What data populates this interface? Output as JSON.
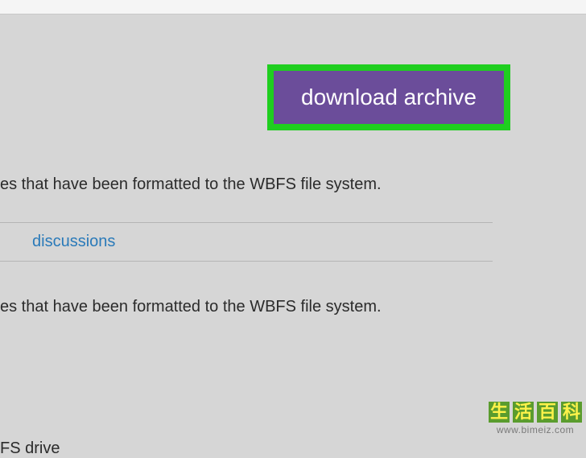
{
  "download_button": {
    "label": "download archive"
  },
  "body_text_1": "es that have been formatted to the WBFS file system.",
  "tabs": {
    "discussions": "discussions"
  },
  "body_text_2": "es that have been formatted to the WBFS file system.",
  "body_text_3": "FS drive",
  "watermark": {
    "chars": [
      "生",
      "活",
      "百",
      "科"
    ],
    "url": "www.bimeiz.com"
  }
}
